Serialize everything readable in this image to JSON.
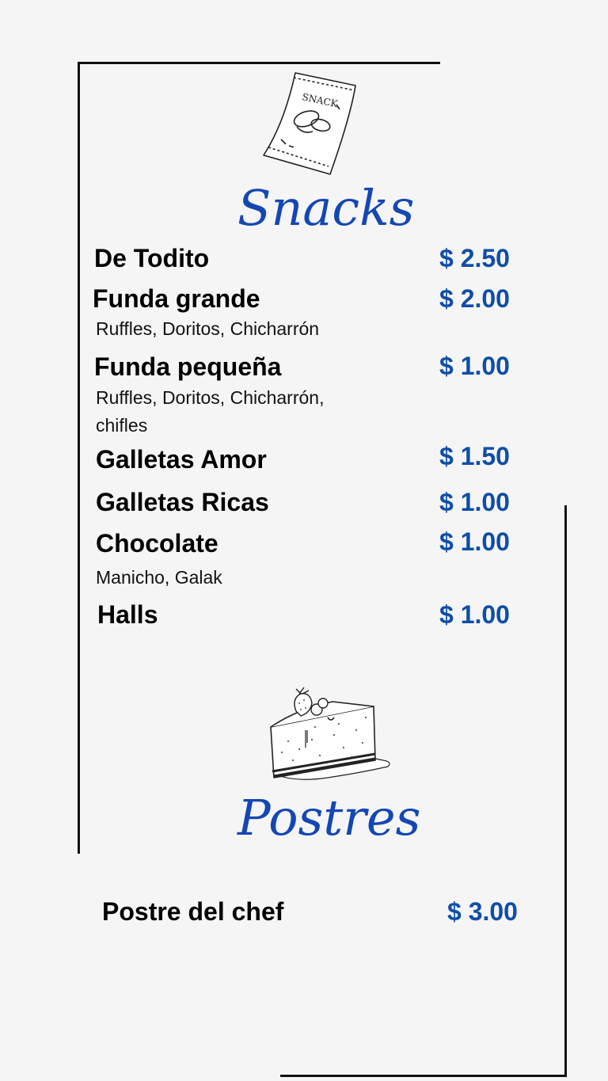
{
  "snacks": {
    "title": "Snacks",
    "items": [
      {
        "name": "De Todito",
        "price": "$ 2.50",
        "desc": ""
      },
      {
        "name": "Funda grande",
        "price": "$ 2.00",
        "desc": "Ruffles, Doritos, Chicharrón"
      },
      {
        "name": "Funda pequeña",
        "price": "$ 1.00",
        "desc": "Ruffles, Doritos, Chicharrón, chifles"
      },
      {
        "name": "Galletas Amor",
        "price": "$ 1.50",
        "desc": ""
      },
      {
        "name": "Galletas Ricas",
        "price": "$ 1.00",
        "desc": ""
      },
      {
        "name": "Chocolate",
        "price": "$ 1.00",
        "desc": "Manicho, Galak"
      },
      {
        "name": "Halls",
        "price": "$ 1.00",
        "desc": ""
      }
    ],
    "illustration": {
      "label": "SNACK",
      "icon": "snack-bag-icon"
    }
  },
  "postres": {
    "title": "Postres",
    "items": [
      {
        "name": "Postre del chef",
        "price": "$ 3.00"
      }
    ],
    "illustration": {
      "icon": "cake-slice-icon"
    }
  },
  "colors": {
    "price": "#0f4ea6",
    "title": "#1447b3",
    "background": "#f5f5f5",
    "frame": "#111111"
  }
}
